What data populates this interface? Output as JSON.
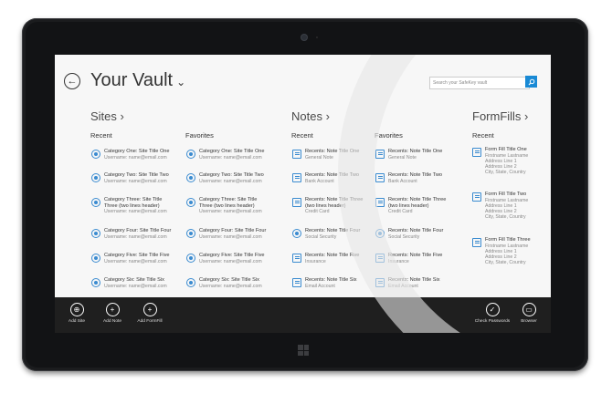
{
  "header": {
    "title": "Your Vault",
    "search_placeholder": "Search your SafeKey vault"
  },
  "sites": {
    "title": "Sites ›",
    "recent_head": "Recent",
    "fav_head": "Favorites",
    "recent": [
      {
        "title": "Category One: Site Title One",
        "sub": "Username: name@email.com"
      },
      {
        "title": "Category Two: Site Title Two",
        "sub": "Username: name@email.com"
      },
      {
        "title": "Category Three: Site Title Three (two lines header)",
        "sub": "Username: name@email.com"
      },
      {
        "title": "Category Four: Site Title Four",
        "sub": "Username: name@email.com"
      },
      {
        "title": "Category Five: Site Title Five",
        "sub": "Username: name@email.com"
      },
      {
        "title": "Category Six: Site Title Six",
        "sub": "Username: name@email.com"
      }
    ],
    "favorites": [
      {
        "title": "Category One: Site Title One",
        "sub": "Username: name@email.com"
      },
      {
        "title": "Category Two: Site Title Two",
        "sub": "Username: name@email.com"
      },
      {
        "title": "Category Three: Site Title Three (two lines header)",
        "sub": "Username: name@email.com"
      },
      {
        "title": "Category Four: Site Title Four",
        "sub": "Username: name@email.com"
      },
      {
        "title": "Category Five: Site Title Five",
        "sub": "Username: name@email.com"
      },
      {
        "title": "Category Six: Site Title Six",
        "sub": "Username: name@email.com"
      }
    ]
  },
  "notes": {
    "title": "Notes ›",
    "recent_head": "Recent",
    "fav_head": "Favorites",
    "recent": [
      {
        "title": "Recents: Note Title One",
        "sub": "General Note"
      },
      {
        "title": "Recents: Note Title Two",
        "sub": "Bank Account"
      },
      {
        "title": "Recents: Note Title Three (two lines header)",
        "sub": "Credit Card"
      },
      {
        "title": "Recents: Note Title Four",
        "sub": "Social Security"
      },
      {
        "title": "Recents: Note Title Five",
        "sub": "Insurance"
      },
      {
        "title": "Recents: Note Title Six",
        "sub": "Email Account"
      }
    ],
    "favorites": [
      {
        "title": "Recents: Note Title One",
        "sub": "General Note"
      },
      {
        "title": "Recents: Note Title Two",
        "sub": "Bank Account"
      },
      {
        "title": "Recents: Note Title Three (two lines header)",
        "sub": "Credit Card"
      },
      {
        "title": "Recents: Note Title Four",
        "sub": "Social Security"
      },
      {
        "title": "Recents: Note Title Five",
        "sub": "Insurance"
      },
      {
        "title": "Recents: Note Title Six",
        "sub": "Email Account"
      }
    ]
  },
  "formfills": {
    "title": "FormFills ›",
    "recent_head": "Recent",
    "recent": [
      {
        "title": "Form Fill Title One",
        "l1": "Firstname Lastname",
        "l2": "Address Line 1",
        "l3": "Address Line 2",
        "l4": "City, State, Country"
      },
      {
        "title": "Form Fill Title Two",
        "l1": "Firstname Lastname",
        "l2": "Address Line 1",
        "l3": "Address Line 2",
        "l4": "City, State, Country"
      },
      {
        "title": "Form Fill Title Three",
        "l1": "Firstname Lastname",
        "l2": "Address Line 1",
        "l3": "Address Line 2",
        "l4": "City, State, Country"
      }
    ]
  },
  "appbar": {
    "add_site": "Add Site",
    "add_note": "Add Note",
    "add_formfill": "Add FormFill",
    "check_passwords": "Check Passwords",
    "browser": "Browser"
  }
}
